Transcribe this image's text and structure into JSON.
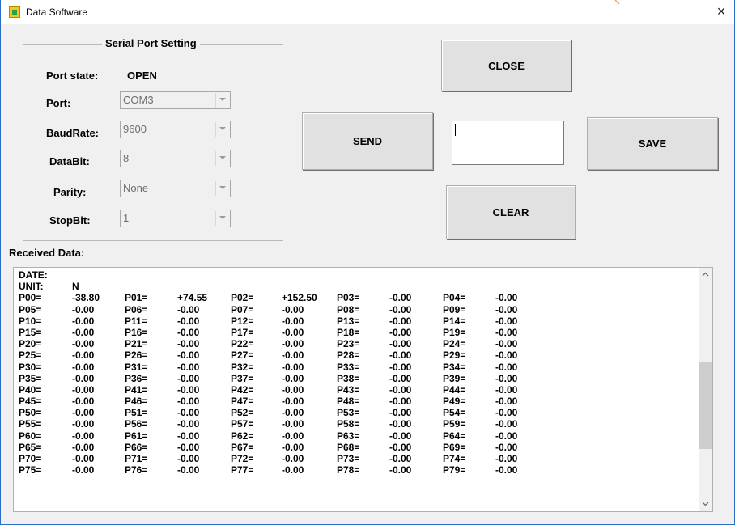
{
  "window": {
    "title": "Data Software",
    "close_glyph": "×"
  },
  "serial": {
    "group_title": "Serial Port Setting",
    "port_state_label": "Port state:",
    "port_state_value": "OPEN",
    "port_label": "Port:",
    "port_value": "COM3",
    "baud_label": "BaudRate:",
    "baud_value": "9600",
    "databit_label": "DataBit:",
    "databit_value": "8",
    "parity_label": "Parity:",
    "parity_value": "None",
    "stopbit_label": "StopBit:",
    "stopbit_value": "1"
  },
  "buttons": {
    "close": "CLOSE",
    "send": "SEND",
    "save": "SAVE",
    "clear": "CLEAR"
  },
  "send_input": {
    "value": ""
  },
  "received": {
    "label": "Received Data:",
    "date_label": "DATE:",
    "unit_label": "UNIT:",
    "unit_value": "N",
    "rows": [
      [
        [
          "P00=",
          "-38.80"
        ],
        [
          "P01=",
          "+74.55"
        ],
        [
          "P02=",
          "+152.50"
        ],
        [
          "P03=",
          "-0.00"
        ],
        [
          "P04=",
          "-0.00"
        ]
      ],
      [
        [
          "P05=",
          "-0.00"
        ],
        [
          "P06=",
          "-0.00"
        ],
        [
          "P07=",
          "-0.00"
        ],
        [
          "P08=",
          "-0.00"
        ],
        [
          "P09=",
          "-0.00"
        ]
      ],
      [
        [
          "P10=",
          "-0.00"
        ],
        [
          "P11=",
          "-0.00"
        ],
        [
          "P12=",
          "-0.00"
        ],
        [
          "P13=",
          "-0.00"
        ],
        [
          "P14=",
          "-0.00"
        ]
      ],
      [
        [
          "P15=",
          "-0.00"
        ],
        [
          "P16=",
          "-0.00"
        ],
        [
          "P17=",
          "-0.00"
        ],
        [
          "P18=",
          "-0.00"
        ],
        [
          "P19=",
          "-0.00"
        ]
      ],
      [
        [
          "P20=",
          "-0.00"
        ],
        [
          "P21=",
          "-0.00"
        ],
        [
          "P22=",
          "-0.00"
        ],
        [
          "P23=",
          "-0.00"
        ],
        [
          "P24=",
          "-0.00"
        ]
      ],
      [
        [
          "P25=",
          "-0.00"
        ],
        [
          "P26=",
          "-0.00"
        ],
        [
          "P27=",
          "-0.00"
        ],
        [
          "P28=",
          "-0.00"
        ],
        [
          "P29=",
          "-0.00"
        ]
      ],
      [
        [
          "P30=",
          "-0.00"
        ],
        [
          "P31=",
          "-0.00"
        ],
        [
          "P32=",
          "-0.00"
        ],
        [
          "P33=",
          "-0.00"
        ],
        [
          "P34=",
          "-0.00"
        ]
      ],
      [
        [
          "P35=",
          "-0.00"
        ],
        [
          "P36=",
          "-0.00"
        ],
        [
          "P37=",
          "-0.00"
        ],
        [
          "P38=",
          "-0.00"
        ],
        [
          "P39=",
          "-0.00"
        ]
      ],
      [
        [
          "P40=",
          "-0.00"
        ],
        [
          "P41=",
          "-0.00"
        ],
        [
          "P42=",
          "-0.00"
        ],
        [
          "P43=",
          "-0.00"
        ],
        [
          "P44=",
          "-0.00"
        ]
      ],
      [
        [
          "P45=",
          "-0.00"
        ],
        [
          "P46=",
          "-0.00"
        ],
        [
          "P47=",
          "-0.00"
        ],
        [
          "P48=",
          "-0.00"
        ],
        [
          "P49=",
          "-0.00"
        ]
      ],
      [
        [
          "P50=",
          "-0.00"
        ],
        [
          "P51=",
          "-0.00"
        ],
        [
          "P52=",
          "-0.00"
        ],
        [
          "P53=",
          "-0.00"
        ],
        [
          "P54=",
          "-0.00"
        ]
      ],
      [
        [
          "P55=",
          "-0.00"
        ],
        [
          "P56=",
          "-0.00"
        ],
        [
          "P57=",
          "-0.00"
        ],
        [
          "P58=",
          "-0.00"
        ],
        [
          "P59=",
          "-0.00"
        ]
      ],
      [
        [
          "P60=",
          "-0.00"
        ],
        [
          "P61=",
          "-0.00"
        ],
        [
          "P62=",
          "-0.00"
        ],
        [
          "P63=",
          "-0.00"
        ],
        [
          "P64=",
          "-0.00"
        ]
      ],
      [
        [
          "P65=",
          "-0.00"
        ],
        [
          "P66=",
          "-0.00"
        ],
        [
          "P67=",
          "-0.00"
        ],
        [
          "P68=",
          "-0.00"
        ],
        [
          "P69=",
          "-0.00"
        ]
      ],
      [
        [
          "P70=",
          "-0.00"
        ],
        [
          "P71=",
          "-0.00"
        ],
        [
          "P72=",
          "-0.00"
        ],
        [
          "P73=",
          "-0.00"
        ],
        [
          "P74=",
          "-0.00"
        ]
      ],
      [
        [
          "P75=",
          "-0.00"
        ],
        [
          "P76=",
          "-0.00"
        ],
        [
          "P77=",
          "-0.00"
        ],
        [
          "P78=",
          "-0.00"
        ],
        [
          "P79=",
          "-0.00"
        ]
      ]
    ]
  },
  "icons": {
    "app": "app-icon",
    "combo_arrow": "chevron-down-icon",
    "scroll_up": "chevron-up-icon",
    "scroll_down": "chevron-down-icon"
  },
  "colors": {
    "window_border": "#2b6cc4",
    "button_face": "#e1e1e1",
    "background": "#f0f0f0"
  }
}
